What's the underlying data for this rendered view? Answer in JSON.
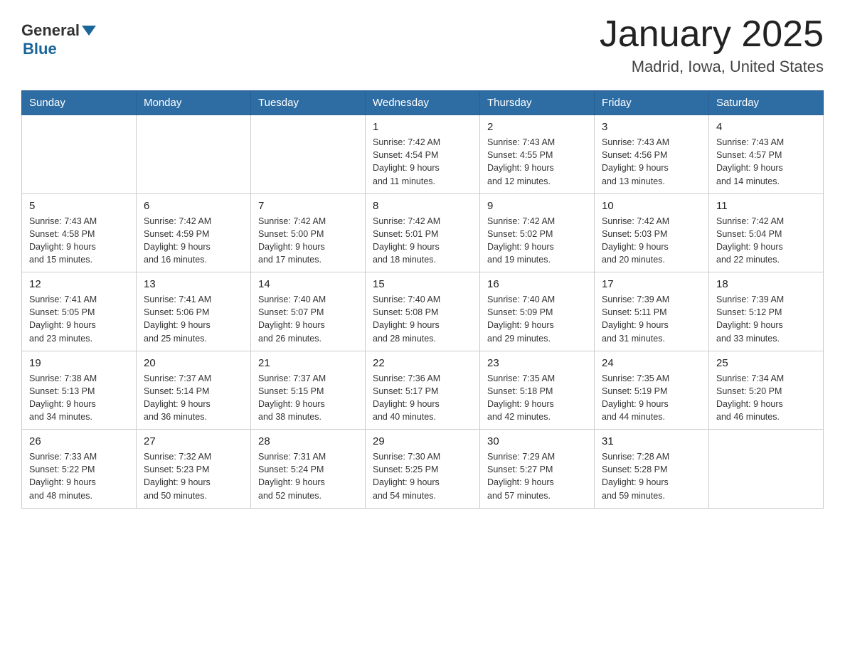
{
  "header": {
    "logo": {
      "general": "General",
      "blue": "Blue"
    },
    "title": "January 2025",
    "subtitle": "Madrid, Iowa, United States"
  },
  "days_of_week": [
    "Sunday",
    "Monday",
    "Tuesday",
    "Wednesday",
    "Thursday",
    "Friday",
    "Saturday"
  ],
  "weeks": [
    [
      {
        "day": "",
        "info": ""
      },
      {
        "day": "",
        "info": ""
      },
      {
        "day": "",
        "info": ""
      },
      {
        "day": "1",
        "info": "Sunrise: 7:42 AM\nSunset: 4:54 PM\nDaylight: 9 hours\nand 11 minutes."
      },
      {
        "day": "2",
        "info": "Sunrise: 7:43 AM\nSunset: 4:55 PM\nDaylight: 9 hours\nand 12 minutes."
      },
      {
        "day": "3",
        "info": "Sunrise: 7:43 AM\nSunset: 4:56 PM\nDaylight: 9 hours\nand 13 minutes."
      },
      {
        "day": "4",
        "info": "Sunrise: 7:43 AM\nSunset: 4:57 PM\nDaylight: 9 hours\nand 14 minutes."
      }
    ],
    [
      {
        "day": "5",
        "info": "Sunrise: 7:43 AM\nSunset: 4:58 PM\nDaylight: 9 hours\nand 15 minutes."
      },
      {
        "day": "6",
        "info": "Sunrise: 7:42 AM\nSunset: 4:59 PM\nDaylight: 9 hours\nand 16 minutes."
      },
      {
        "day": "7",
        "info": "Sunrise: 7:42 AM\nSunset: 5:00 PM\nDaylight: 9 hours\nand 17 minutes."
      },
      {
        "day": "8",
        "info": "Sunrise: 7:42 AM\nSunset: 5:01 PM\nDaylight: 9 hours\nand 18 minutes."
      },
      {
        "day": "9",
        "info": "Sunrise: 7:42 AM\nSunset: 5:02 PM\nDaylight: 9 hours\nand 19 minutes."
      },
      {
        "day": "10",
        "info": "Sunrise: 7:42 AM\nSunset: 5:03 PM\nDaylight: 9 hours\nand 20 minutes."
      },
      {
        "day": "11",
        "info": "Sunrise: 7:42 AM\nSunset: 5:04 PM\nDaylight: 9 hours\nand 22 minutes."
      }
    ],
    [
      {
        "day": "12",
        "info": "Sunrise: 7:41 AM\nSunset: 5:05 PM\nDaylight: 9 hours\nand 23 minutes."
      },
      {
        "day": "13",
        "info": "Sunrise: 7:41 AM\nSunset: 5:06 PM\nDaylight: 9 hours\nand 25 minutes."
      },
      {
        "day": "14",
        "info": "Sunrise: 7:40 AM\nSunset: 5:07 PM\nDaylight: 9 hours\nand 26 minutes."
      },
      {
        "day": "15",
        "info": "Sunrise: 7:40 AM\nSunset: 5:08 PM\nDaylight: 9 hours\nand 28 minutes."
      },
      {
        "day": "16",
        "info": "Sunrise: 7:40 AM\nSunset: 5:09 PM\nDaylight: 9 hours\nand 29 minutes."
      },
      {
        "day": "17",
        "info": "Sunrise: 7:39 AM\nSunset: 5:11 PM\nDaylight: 9 hours\nand 31 minutes."
      },
      {
        "day": "18",
        "info": "Sunrise: 7:39 AM\nSunset: 5:12 PM\nDaylight: 9 hours\nand 33 minutes."
      }
    ],
    [
      {
        "day": "19",
        "info": "Sunrise: 7:38 AM\nSunset: 5:13 PM\nDaylight: 9 hours\nand 34 minutes."
      },
      {
        "day": "20",
        "info": "Sunrise: 7:37 AM\nSunset: 5:14 PM\nDaylight: 9 hours\nand 36 minutes."
      },
      {
        "day": "21",
        "info": "Sunrise: 7:37 AM\nSunset: 5:15 PM\nDaylight: 9 hours\nand 38 minutes."
      },
      {
        "day": "22",
        "info": "Sunrise: 7:36 AM\nSunset: 5:17 PM\nDaylight: 9 hours\nand 40 minutes."
      },
      {
        "day": "23",
        "info": "Sunrise: 7:35 AM\nSunset: 5:18 PM\nDaylight: 9 hours\nand 42 minutes."
      },
      {
        "day": "24",
        "info": "Sunrise: 7:35 AM\nSunset: 5:19 PM\nDaylight: 9 hours\nand 44 minutes."
      },
      {
        "day": "25",
        "info": "Sunrise: 7:34 AM\nSunset: 5:20 PM\nDaylight: 9 hours\nand 46 minutes."
      }
    ],
    [
      {
        "day": "26",
        "info": "Sunrise: 7:33 AM\nSunset: 5:22 PM\nDaylight: 9 hours\nand 48 minutes."
      },
      {
        "day": "27",
        "info": "Sunrise: 7:32 AM\nSunset: 5:23 PM\nDaylight: 9 hours\nand 50 minutes."
      },
      {
        "day": "28",
        "info": "Sunrise: 7:31 AM\nSunset: 5:24 PM\nDaylight: 9 hours\nand 52 minutes."
      },
      {
        "day": "29",
        "info": "Sunrise: 7:30 AM\nSunset: 5:25 PM\nDaylight: 9 hours\nand 54 minutes."
      },
      {
        "day": "30",
        "info": "Sunrise: 7:29 AM\nSunset: 5:27 PM\nDaylight: 9 hours\nand 57 minutes."
      },
      {
        "day": "31",
        "info": "Sunrise: 7:28 AM\nSunset: 5:28 PM\nDaylight: 9 hours\nand 59 minutes."
      },
      {
        "day": "",
        "info": ""
      }
    ]
  ]
}
